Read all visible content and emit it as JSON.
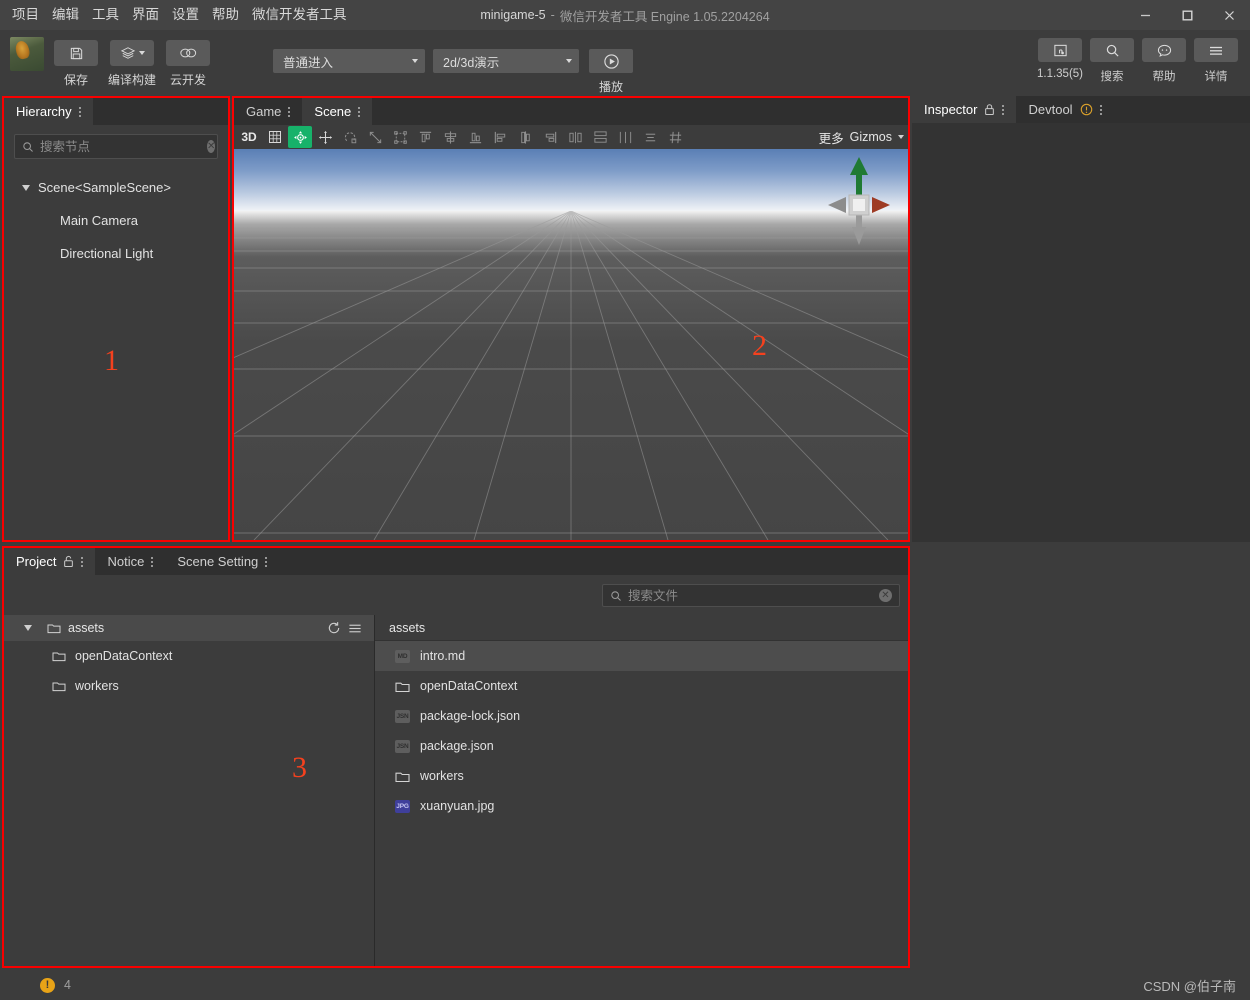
{
  "window": {
    "title_main": "minigame-5",
    "title_sep": "-",
    "title_sub": "微信开发者工具 Engine 1.05.2204264",
    "minimize": "minimize-button",
    "maximize": "maximize-button",
    "close": "close-button"
  },
  "menubar": {
    "items": [
      {
        "label": "项目"
      },
      {
        "label": "编辑"
      },
      {
        "label": "工具"
      },
      {
        "label": "界面"
      },
      {
        "label": "设置"
      },
      {
        "label": "帮助"
      },
      {
        "label": "微信开发者工具"
      }
    ]
  },
  "toolbar": {
    "left_buttons": [
      {
        "label": "保存",
        "icon": "save-icon"
      },
      {
        "label": "编译构建",
        "icon": "layers-icon"
      },
      {
        "label": "云开发",
        "icon": "cloud-icon"
      }
    ],
    "dropdown_mode": {
      "value": "普通进入"
    },
    "dropdown_scene": {
      "value": "2d/3d演示"
    },
    "play": {
      "label": "播放",
      "icon": "play-icon"
    },
    "right_buttons": [
      {
        "label": "1.1.35(5)",
        "icon": "version-icon"
      },
      {
        "label": "搜索",
        "icon": "search-icon"
      },
      {
        "label": "帮助",
        "icon": "help-chat-icon"
      },
      {
        "label": "详情",
        "icon": "menu-lines-icon"
      }
    ]
  },
  "hierarchy": {
    "tab": "Hierarchy",
    "search_placeholder": "搜索节点",
    "search_value": "",
    "tree": [
      {
        "label": "Scene<SampleScene>",
        "level": 0,
        "expanded": true
      },
      {
        "label": "Main Camera",
        "level": 1
      },
      {
        "label": "Directional Light",
        "level": 1
      }
    ],
    "annotation": "1"
  },
  "scene": {
    "tabs": [
      {
        "label": "Game",
        "active": false
      },
      {
        "label": "Scene",
        "active": true
      }
    ],
    "toolbar": {
      "mode_3d": "3D",
      "tools": [
        {
          "name": "grid-icon",
          "active": false
        },
        {
          "name": "move-tool-icon",
          "active": true
        },
        {
          "name": "translate-tool-icon",
          "active": false
        },
        {
          "name": "rotate-tool-icon",
          "active": false
        },
        {
          "name": "scale-tool-icon",
          "active": false
        },
        {
          "name": "rect-tool-icon",
          "active": false
        },
        {
          "name": "align-top-icon",
          "active": false
        },
        {
          "name": "align-center-v-icon",
          "active": false
        },
        {
          "name": "align-bottom-icon",
          "active": false
        },
        {
          "name": "align-left-icon",
          "active": false
        },
        {
          "name": "align-center-h-icon",
          "active": false
        },
        {
          "name": "align-right-icon",
          "active": false
        },
        {
          "name": "distribute-h-icon",
          "active": false
        },
        {
          "name": "distribute-v-icon",
          "active": false
        },
        {
          "name": "distribute-gap-icon",
          "active": false
        },
        {
          "name": "list-icon",
          "active": false
        },
        {
          "name": "snap-grid-icon",
          "active": false
        }
      ],
      "more_label": "更多",
      "gizmos_label": "Gizmos"
    },
    "annotation": "2"
  },
  "inspector": {
    "tabs": [
      {
        "label": "Inspector",
        "icon": "lock-icon",
        "active": true
      },
      {
        "label": "Devtool",
        "icon": "warning-icon",
        "active": false
      }
    ]
  },
  "project": {
    "tabs": [
      {
        "label": "Project",
        "icon": "unlock-icon",
        "active": true
      },
      {
        "label": "Notice",
        "icon": "",
        "active": false
      },
      {
        "label": "Scene Setting",
        "icon": "",
        "active": false
      }
    ],
    "search_placeholder": "搜索文件",
    "search_value": "",
    "tree": {
      "root": {
        "label": "assets",
        "expanded": true,
        "refresh_icon": "refresh-icon",
        "menu_icon": "menu-icon"
      },
      "children": [
        {
          "label": "openDataContext",
          "icon": "folder-icon"
        },
        {
          "label": "workers",
          "icon": "folder-icon"
        }
      ]
    },
    "list": {
      "header": "assets",
      "files": [
        {
          "name": "intro.md",
          "type": "MD",
          "kind": "file",
          "selected": true
        },
        {
          "name": "openDataContext",
          "type": "",
          "kind": "folder",
          "selected": false
        },
        {
          "name": "package-lock.json",
          "type": "JSN",
          "kind": "file",
          "selected": false
        },
        {
          "name": "package.json",
          "type": "JSN",
          "kind": "file",
          "selected": false
        },
        {
          "name": "workers",
          "type": "",
          "kind": "folder",
          "selected": false
        },
        {
          "name": "xuanyuan.jpg",
          "type": "JPG",
          "kind": "file",
          "selected": false
        }
      ]
    },
    "annotation": "3"
  },
  "statusbar": {
    "warning_count": "4",
    "warning_icon": "warning-circle-icon",
    "watermark": "CSDN @伯子南"
  },
  "colors": {
    "annotation_red": "#fa0000",
    "annotation_number": "#f5411e",
    "accent_green": "#17b26a",
    "warning_orange": "#e8a317"
  }
}
